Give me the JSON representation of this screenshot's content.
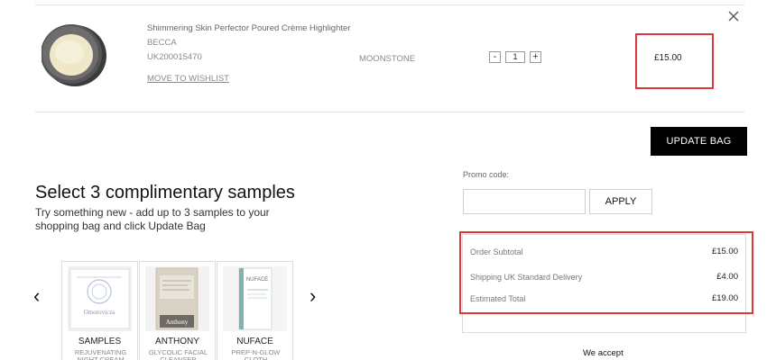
{
  "product": {
    "title": "Shimmering Skin Perfector Poured Crème Highlighter",
    "brand": "BECCA",
    "sku": "UK200015470",
    "wishlist_label": "MOVE TO WISHLIST",
    "shade": "MOONSTONE",
    "quantity": "1",
    "minus_label": "-",
    "plus_label": "+",
    "price": "£15.00"
  },
  "update_bag_label": "UPDATE BAG",
  "samples": {
    "heading": "Select 3 complimentary samples",
    "description": "Try something new - add up to 3 samples to your shopping bag and click Update Bag",
    "items": [
      {
        "name": "SAMPLES",
        "desc": "REJUVENATING NIGHT CREAM",
        "packaging_text": "Omorovicza"
      },
      {
        "name": "ANTHONY",
        "desc": "GLYCOLIC FACIAL CLEANSER",
        "packaging_text": "Anthony"
      },
      {
        "name": "NUFACE",
        "desc": "PREP-N-GLOW CLOTH",
        "packaging_text": "NUFACE"
      }
    ]
  },
  "promo": {
    "label": "Promo code:",
    "input_value": "",
    "apply_label": "APPLY"
  },
  "totals": {
    "rows": [
      {
        "label": "Order Subtotal",
        "value": "£15.00"
      },
      {
        "label": "Shipping UK Standard Delivery",
        "value": "£4.00"
      },
      {
        "label": "Estimated Total",
        "value": "£19.00"
      }
    ]
  },
  "we_accept_label": "We accept",
  "colors": {
    "highlight_red": "#d9363e",
    "button_black": "#000000"
  }
}
